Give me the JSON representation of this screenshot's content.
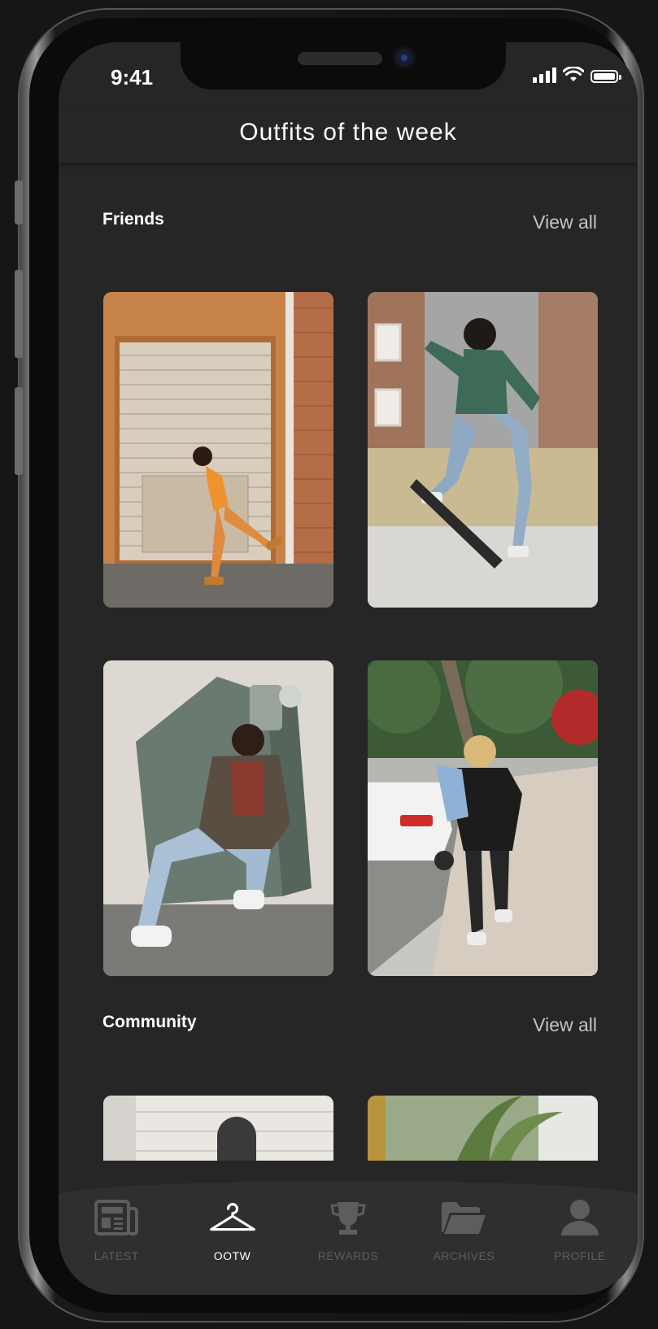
{
  "status_bar": {
    "time": "9:41"
  },
  "header": {
    "title": "Outfits of the week"
  },
  "sections": [
    {
      "title": "Friends",
      "view_all": "View all"
    },
    {
      "title": "Community",
      "view_all": "View all"
    }
  ],
  "friends_photos": [
    {
      "alt": "person in orange outfit leaning against roller door"
    },
    {
      "alt": "skateboarder doing a kickflip"
    },
    {
      "alt": "person crouching in front of utility box"
    },
    {
      "alt": "person walking on sidewalk holding denim jacket"
    }
  ],
  "tab_bar": {
    "items": [
      {
        "label": "LATEST",
        "icon": "newspaper-icon",
        "active": false
      },
      {
        "label": "OOTW",
        "icon": "hanger-icon",
        "active": true
      },
      {
        "label": "REWARDS",
        "icon": "trophy-icon",
        "active": false
      },
      {
        "label": "ARCHIVES",
        "icon": "folder-icon",
        "active": false
      },
      {
        "label": "PROFILE",
        "icon": "user-icon",
        "active": false
      }
    ]
  },
  "colors": {
    "background": "#262626",
    "tab_inactive": "#5d5d5d",
    "tab_active": "#ffffff"
  }
}
